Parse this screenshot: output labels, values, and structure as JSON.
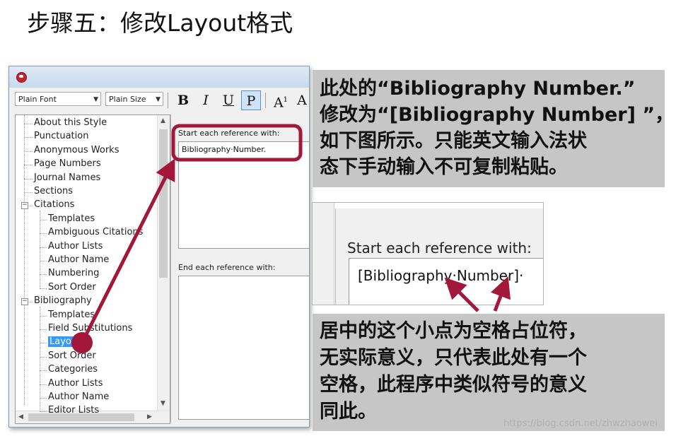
{
  "heading": "步骤五：修改Layout格式",
  "toolbar": {
    "font": "Plain Font",
    "size": "Plain Size",
    "bold": "B",
    "italic": "I",
    "underline": "U",
    "plain": "P",
    "superscript": "A",
    "superscript_mark": "1",
    "subscript": "A"
  },
  "tree": {
    "items": [
      "About this Style",
      "Punctuation",
      "Anonymous Works",
      "Page Numbers",
      "Journal Names",
      "Sections",
      "Citations",
      "Templates",
      "Ambiguous Citations",
      "Author Lists",
      "Author Name",
      "Numbering",
      "Sort Order",
      "Bibliography",
      "Templates",
      "Field Substitutions",
      "Layout",
      "Sort Order",
      "Categories",
      "Author Lists",
      "Author Name",
      "Editor Lists"
    ],
    "selected": "Layout"
  },
  "panel": {
    "start_label": "Start each reference with:",
    "start_value": "Bibliography·Number.",
    "end_label": "End each reference with:"
  },
  "zoom": {
    "label": "Start each reference with:",
    "value": "[Bibliography·Number]·"
  },
  "callout_top": [
    "此处的“Bibliography Number.”",
    "修改为“[Bibliography Number] ”，",
    "如下图所示。只能英文输入法状",
    "态下手动输入不可复制粘贴。"
  ],
  "callout_bottom": [
    "居中的这个小点为空格占位符，",
    "无实际意义，只代表此处有一个",
    "空格，此程序中类似符号的意义",
    "同此。"
  ],
  "watermark": "https://blog.csdn.net/zhwzhaowei",
  "colors": {
    "arrow": "#a3173a",
    "selection": "#3399ff",
    "callout_bg": "#c6c6c6"
  }
}
